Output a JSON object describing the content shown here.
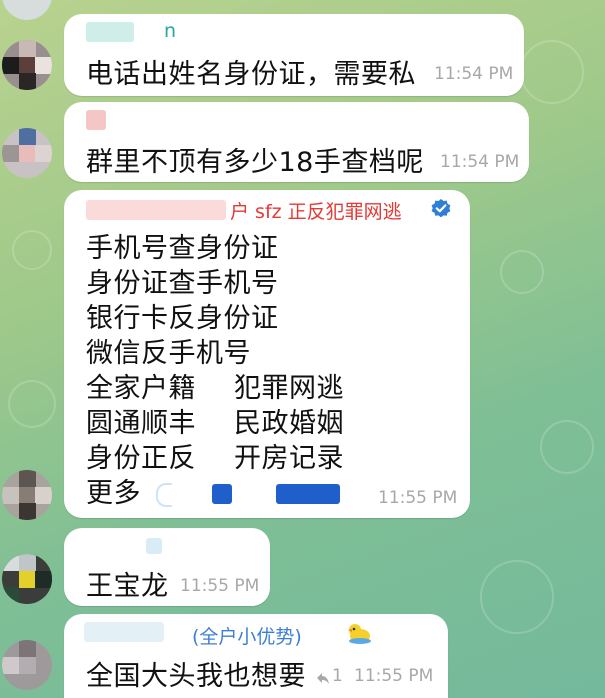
{
  "colors": {
    "accent_sender": "#2aa79b",
    "red_sender": "#e53935",
    "blue_sender": "#3d7fd4",
    "verified": "#2f7fd8",
    "timestamp": "#a8a8a8",
    "bubble": "#ffffff"
  },
  "messages": [
    {
      "sender_fragment": "n",
      "text": "电话出姓名身份证，需要私",
      "time": "11:54 PM"
    },
    {
      "text": "群里不顶有多少18手查档呢",
      "time": "11:54 PM"
    },
    {
      "sender_fragment": "户 sfz 正反犯罪网逃",
      "sender_badge_icon": "verified-badge-icon",
      "lines": [
        "手机号查身份证",
        "身份证查手机号",
        "银行卡反身份证",
        "微信反手机号"
      ],
      "pairs": [
        [
          "全家户籍",
          "犯罪网逃"
        ],
        [
          "圆通顺丰",
          "民政婚姻"
        ],
        [
          "身份正反",
          "开房记录"
        ]
      ],
      "last_line": "更多",
      "time": "11:55 PM"
    },
    {
      "text": "王宝龙",
      "time": "11:55 PM"
    },
    {
      "sender_fragment": "(全户小优势)",
      "sender_emoji_icon": "duck-emoji-icon",
      "text": "全国大头我也想要",
      "reply_count": "1",
      "reply_icon": "reply-arrow-icon",
      "time": "11:55 PM"
    }
  ]
}
